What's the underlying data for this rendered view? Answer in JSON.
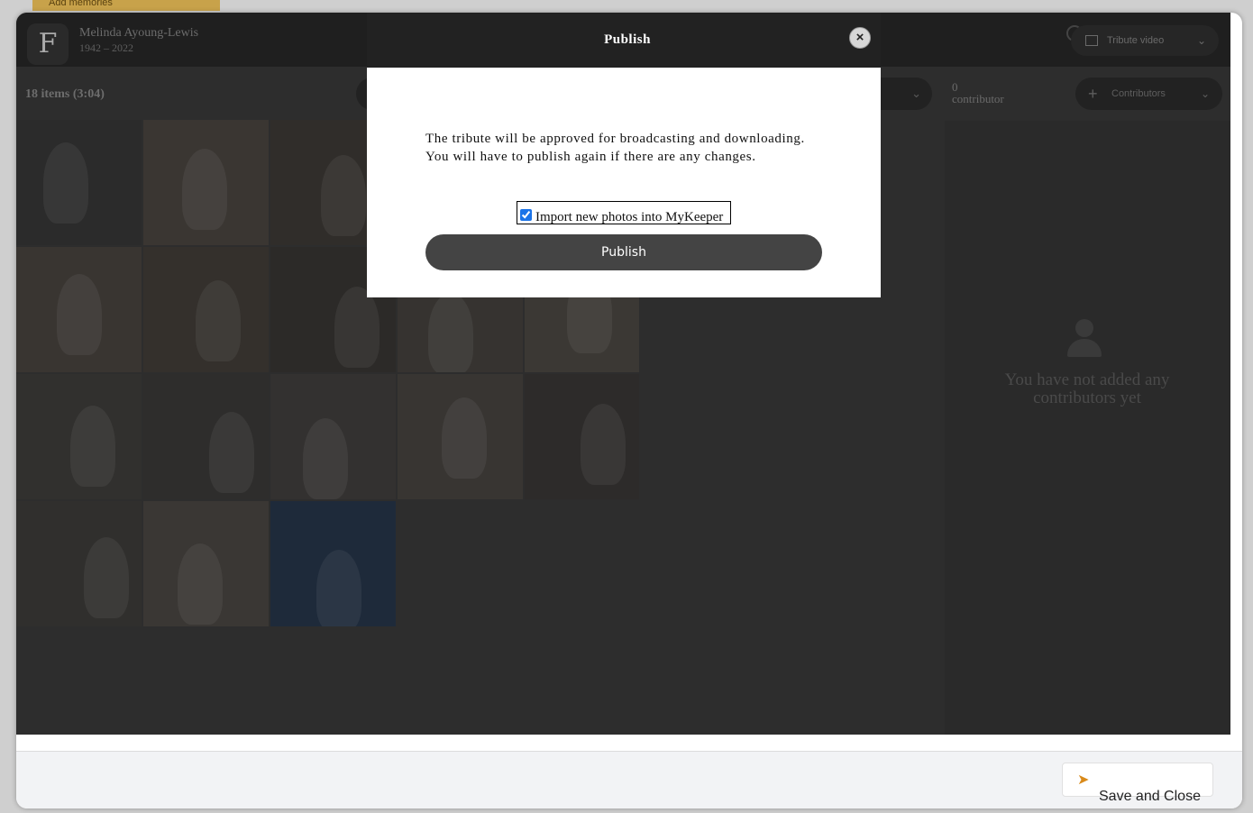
{
  "background_page": {
    "tag_text": "Add memories"
  },
  "editor": {
    "tribute_name": "Melinda Ayoung-Lewis",
    "tribute_dates": "1942 – 2022",
    "logo_letter": "F",
    "video_selector_label": "Tribute video",
    "items_count": "18 items (3:04)",
    "contributors_count": "0",
    "contributors_label": "contributor",
    "contributors_button": "Contributors",
    "empty_contributors_text": "You have not added any contributors yet",
    "photo_count": 18
  },
  "modal": {
    "title": "Publish",
    "close_label": "×",
    "message_line1": "The tribute will be approved for broadcasting and downloading.",
    "message_line2": "You will have to publish again if there are any changes.",
    "checkbox_label": "Import new photos into MyKeeper",
    "checkbox_checked": true,
    "publish_label": "Publish"
  },
  "footer": {
    "save_close_label": "Save and Close",
    "arrow_glyph": "➤"
  },
  "colors": {
    "accent_orange": "#d98a1a",
    "modal_header": "#222222",
    "publish_button": "#444444",
    "checkbox_blue": "#1a73e8"
  }
}
